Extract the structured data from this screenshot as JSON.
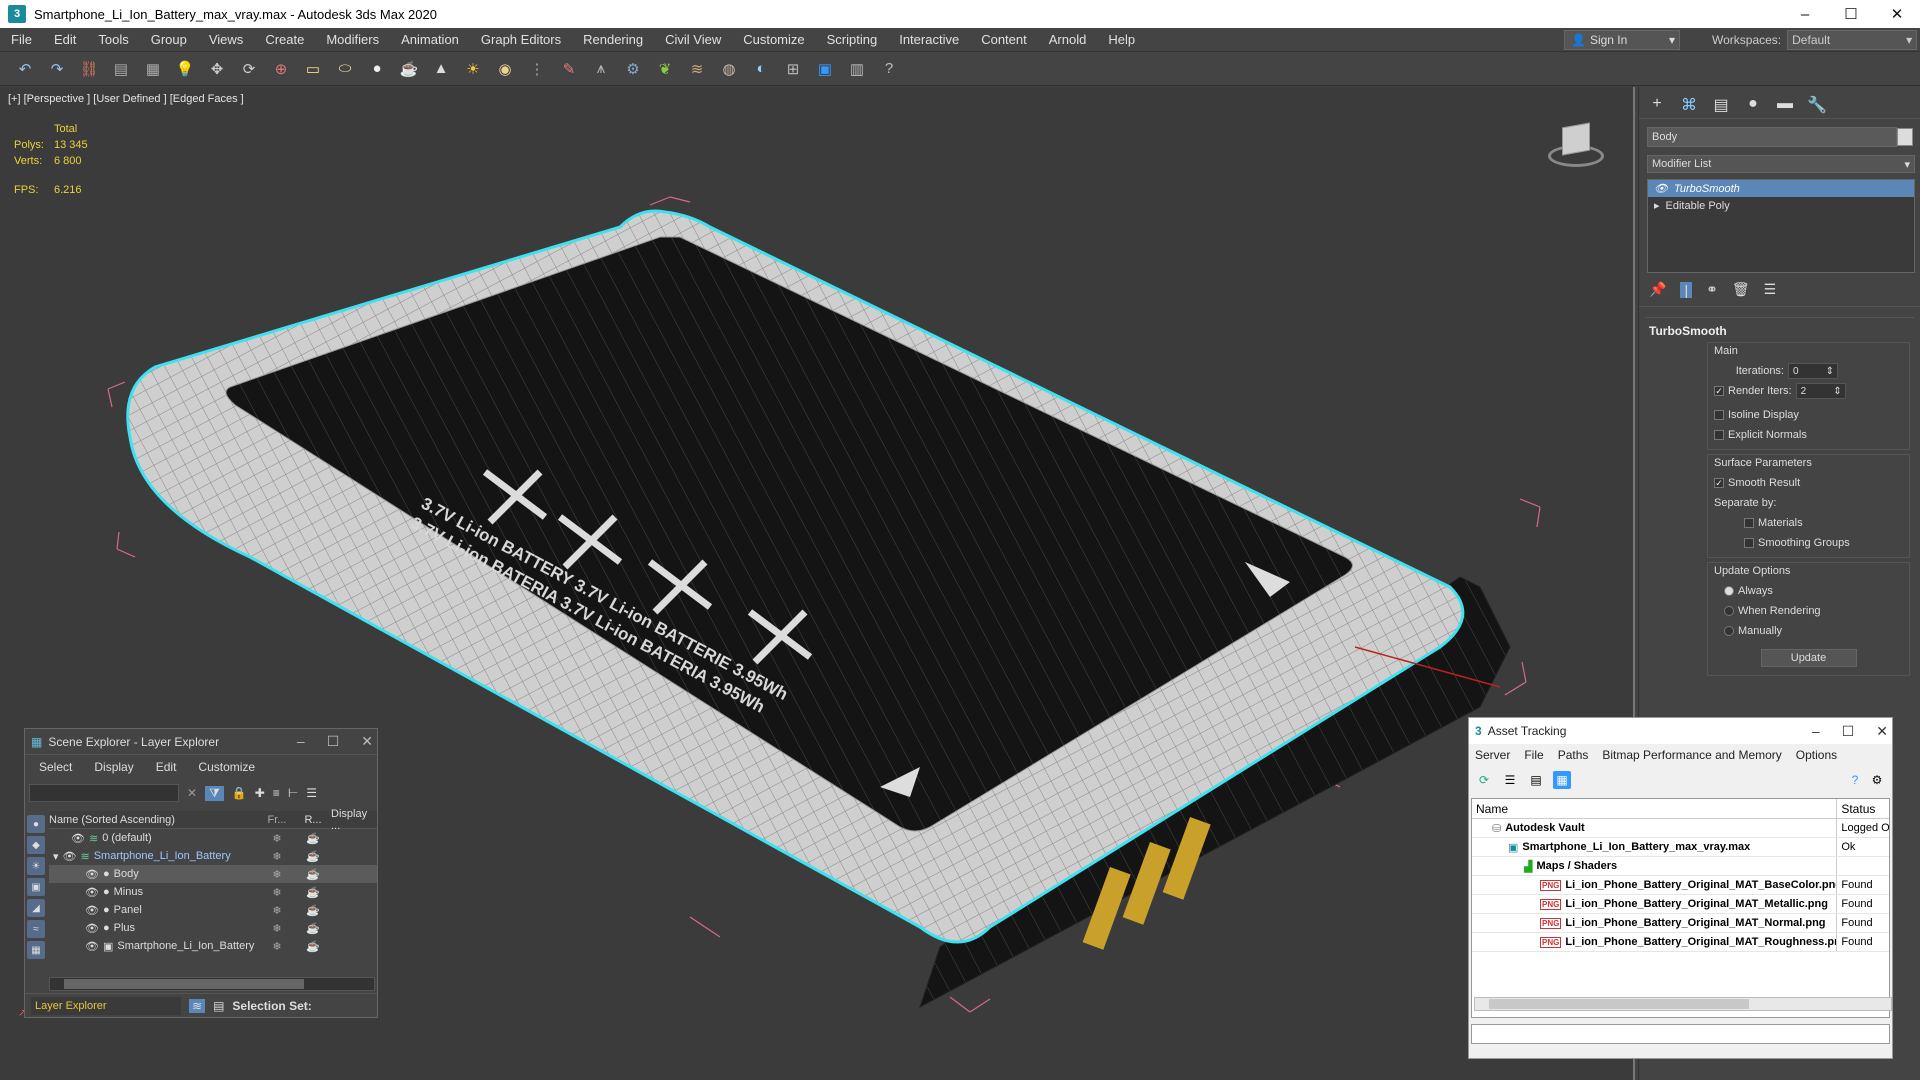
{
  "window": {
    "title": "Smartphone_Li_Ion_Battery_max_vray.max - Autodesk 3ds Max 2020",
    "app_icon": "3"
  },
  "menu": [
    "File",
    "Edit",
    "Tools",
    "Group",
    "Views",
    "Create",
    "Modifiers",
    "Animation",
    "Graph Editors",
    "Rendering",
    "Civil View",
    "Customize",
    "Scripting",
    "Interactive",
    "Content",
    "Arnold",
    "Help"
  ],
  "signin": {
    "label": "Sign In"
  },
  "workspaces": {
    "label": "Workspaces:",
    "value": "Default"
  },
  "viewport": {
    "label": "[+] [Perspective ] [User Defined ] [Edged Faces ]",
    "stats": {
      "total": "Total",
      "polys_label": "Polys:",
      "polys": "13 345",
      "verts_label": "Verts:",
      "verts": "6 800",
      "fps_label": "FPS:",
      "fps": "6.216"
    },
    "battery_text_line1": "3.7V Li-ion BATTERY 3.7V Li-ion BATTERIE 3.95Wh",
    "battery_text_line2": "3.7V Li-ion BATERIA 3.7V Li-ion BATERIA 3.95Wh"
  },
  "command_panel": {
    "object_name": "Body",
    "modifier_list": "Modifier List",
    "stack": [
      "TurboSmooth",
      "Editable Poly"
    ],
    "rollout": {
      "title": "TurboSmooth",
      "main": "Main",
      "iterations_label": "Iterations:",
      "iterations": "0",
      "render_iters_label": "Render Iters:",
      "render_iters": "2",
      "isoline": "Isoline Display",
      "explicit": "Explicit Normals",
      "surface": "Surface Parameters",
      "smooth_result": "Smooth Result",
      "separate_by": "Separate by:",
      "materials": "Materials",
      "smoothing_groups": "Smoothing Groups",
      "update_options": "Update Options",
      "always": "Always",
      "when_rendering": "When Rendering",
      "manually": "Manually",
      "update": "Update"
    }
  },
  "scene_explorer": {
    "title": "Scene Explorer - Layer Explorer",
    "menu": [
      "Select",
      "Display",
      "Edit",
      "Customize"
    ],
    "columns": [
      "Name (Sorted Ascending)",
      "Fr...",
      "R...",
      "Display ..."
    ],
    "rows": [
      {
        "name": "0 (default)",
        "indent": 0
      },
      {
        "name": "Smartphone_Li_Ion_Battery",
        "indent": 0
      },
      {
        "name": "Body",
        "indent": 1
      },
      {
        "name": "Minus",
        "indent": 1
      },
      {
        "name": "Panel",
        "indent": 1
      },
      {
        "name": "Plus",
        "indent": 1
      },
      {
        "name": "Smartphone_Li_Ion_Battery",
        "indent": 1
      }
    ],
    "footer_explorer": "Layer Explorer",
    "selection_set": "Selection Set:"
  },
  "asset_tracking": {
    "title": "Asset Tracking",
    "menu": [
      "Server",
      "File",
      "Paths",
      "Bitmap Performance and Memory",
      "Options"
    ],
    "columns": [
      "Name",
      "Status"
    ],
    "rows": [
      {
        "name": "Autodesk Vault",
        "status": "Logged O"
      },
      {
        "name": "Smartphone_Li_Ion_Battery_max_vray.max",
        "status": "Ok"
      },
      {
        "name": "Maps / Shaders",
        "status": ""
      },
      {
        "name": "Li_ion_Phone_Battery_Original_MAT_BaseColor.png",
        "status": "Found"
      },
      {
        "name": "Li_ion_Phone_Battery_Original_MAT_Metallic.png",
        "status": "Found"
      },
      {
        "name": "Li_ion_Phone_Battery_Original_MAT_Normal.png",
        "status": "Found"
      },
      {
        "name": "Li_ion_Phone_Battery_Original_MAT_Roughness.png",
        "status": "Found"
      }
    ]
  },
  "colors": {
    "selection_outline": "#3fe0f0",
    "stats_yellow": "#e8d23a",
    "active_blue": "#5b86b8"
  }
}
